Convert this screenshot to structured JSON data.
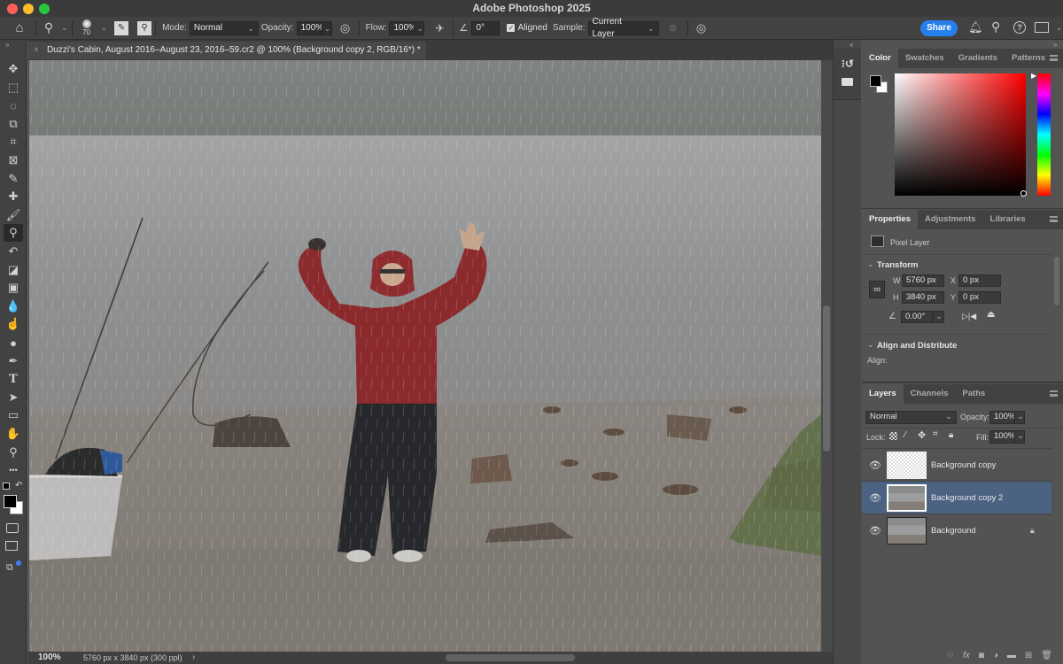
{
  "app": {
    "title": "Adobe Photoshop 2025"
  },
  "window_controls": {
    "close_color": "#ff5f57",
    "minimize_color": "#febc2e",
    "maximize_color": "#28c840"
  },
  "options_bar": {
    "brush_size": "70",
    "mode_label": "Mode:",
    "mode_value": "Normal",
    "opacity_label": "Opacity:",
    "opacity_value": "100%",
    "flow_label": "Flow:",
    "flow_value": "100%",
    "angle_value": "0°",
    "aligned_label": "Aligned",
    "aligned_checked": true,
    "sample_label": "Sample:",
    "sample_value": "Current Layer",
    "share_label": "Share"
  },
  "document": {
    "tab_title": "Duzzi's Cabin, August 2016–August 23, 2016–59.cr2 @ 100% (Background copy 2, RGB/16*) *",
    "zoom": "100%",
    "info": "5760 px x 3840 px (300 ppl)"
  },
  "tools": [
    {
      "name": "move-tool",
      "glyph": "✥"
    },
    {
      "name": "marquee-tool",
      "glyph": "⬚"
    },
    {
      "name": "quick-selection-tool",
      "glyph": "◌"
    },
    {
      "name": "object-selection-tool",
      "glyph": "⧉"
    },
    {
      "name": "crop-tool",
      "glyph": "⌗"
    },
    {
      "name": "frame-tool",
      "glyph": "⊠"
    },
    {
      "name": "eyedropper-tool",
      "glyph": "✎"
    },
    {
      "name": "spot-healing-tool",
      "glyph": "✚"
    },
    {
      "name": "brush-tool",
      "glyph": "🖌"
    },
    {
      "name": "clone-stamp-tool",
      "glyph": "⚲"
    },
    {
      "name": "history-brush-tool",
      "glyph": "↶"
    },
    {
      "name": "eraser-tool",
      "glyph": "◪"
    },
    {
      "name": "gradient-tool",
      "glyph": "▣"
    },
    {
      "name": "blur-tool",
      "glyph": "💧"
    },
    {
      "name": "smudge-tool",
      "glyph": "☝"
    },
    {
      "name": "dodge-tool",
      "glyph": "●"
    },
    {
      "name": "pen-tool",
      "glyph": "✒"
    },
    {
      "name": "type-tool",
      "glyph": "T"
    },
    {
      "name": "path-selection-tool",
      "glyph": "➤"
    },
    {
      "name": "rectangle-tool",
      "glyph": "▭"
    },
    {
      "name": "hand-tool",
      "glyph": "✋"
    },
    {
      "name": "zoom-tool",
      "glyph": "⚲"
    },
    {
      "name": "more-tools",
      "glyph": "•••"
    }
  ],
  "color_panel": {
    "tabs": [
      "Color",
      "Swatches",
      "Gradients",
      "Patterns"
    ],
    "active_tab": "Color",
    "hue_color": "#ff0000",
    "foreground": "#000000",
    "background": "#ffffff"
  },
  "properties_panel": {
    "tabs": [
      "Properties",
      "Adjustments",
      "Libraries"
    ],
    "layer_type": "Pixel Layer",
    "transform_label": "Transform",
    "w_label": "W",
    "w_value": "5760 px",
    "h_label": "H",
    "h_value": "3840 px",
    "x_label": "X",
    "x_value": "0 px",
    "y_label": "Y",
    "y_value": "0 px",
    "angle_value": "0.00°",
    "align_section": "Align and Distribute",
    "align_label": "Align:"
  },
  "layers_panel": {
    "tabs": [
      "Layers",
      "Channels",
      "Paths"
    ],
    "blend_mode": "Normal",
    "opacity_label": "Opacity:",
    "opacity_value": "100%",
    "lock_label": "Lock:",
    "fill_label": "Fill:",
    "fill_value": "100%",
    "layers": [
      {
        "name": "Background copy",
        "selected": false,
        "locked": false,
        "transparent": true
      },
      {
        "name": "Background copy 2",
        "selected": true,
        "locked": false,
        "transparent": false
      },
      {
        "name": "Background",
        "selected": false,
        "locked": true,
        "transparent": false
      }
    ]
  }
}
